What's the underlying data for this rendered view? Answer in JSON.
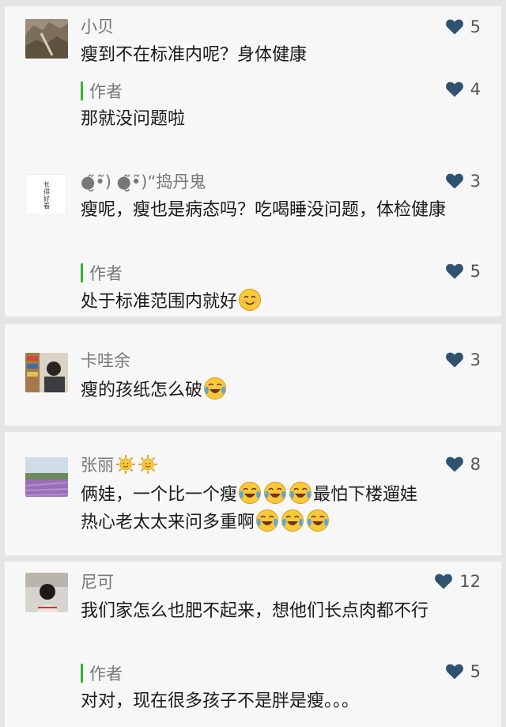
{
  "comments": [
    {
      "nickname": "小贝",
      "text": "瘦到不在标准内呢？身体健康",
      "likes": "5",
      "reply": {
        "label": "作者",
        "text": "那就没问题啦",
        "likes": "4"
      }
    },
    {
      "nickname": "●̮̮̃•̃)  ●̮̮̃•̃)“捣丹鬼",
      "avatar_text": [
        "长",
        "得",
        "好",
        "看"
      ],
      "text": "瘦呢，瘦也是病态吗？吃喝睡没问题，体检健康",
      "likes": "3",
      "reply": {
        "label": "作者",
        "text": "处于标准范围内就好",
        "likes": "5",
        "emoji": "smile-emoji"
      }
    },
    {
      "nickname": "卡哇余",
      "text": "瘦的孩纸怎么破",
      "likes": "3",
      "emoji": "laugh-cry-emoji"
    },
    {
      "nickname": "张丽",
      "nickname_emoji": "sun-emoji",
      "text_line1a": "俩娃，一个比一个瘦",
      "text_line1b": "最怕下楼遛娃",
      "text_line2": "热心老太太来问多重啊",
      "likes": "8",
      "emoji": "laugh-cry-emoji"
    },
    {
      "nickname": "尼可",
      "text": "我们家怎么也肥不起来，想他们长点肉都不行",
      "likes": "12",
      "reply": {
        "label": "作者",
        "text": "对对，现在很多孩子不是胖是瘦。。。",
        "likes": "5"
      }
    }
  ],
  "colors": {
    "accent": "#35b535",
    "heart": "#2f5270",
    "background": "#e5e5e5",
    "card": "#f7f7f7"
  }
}
